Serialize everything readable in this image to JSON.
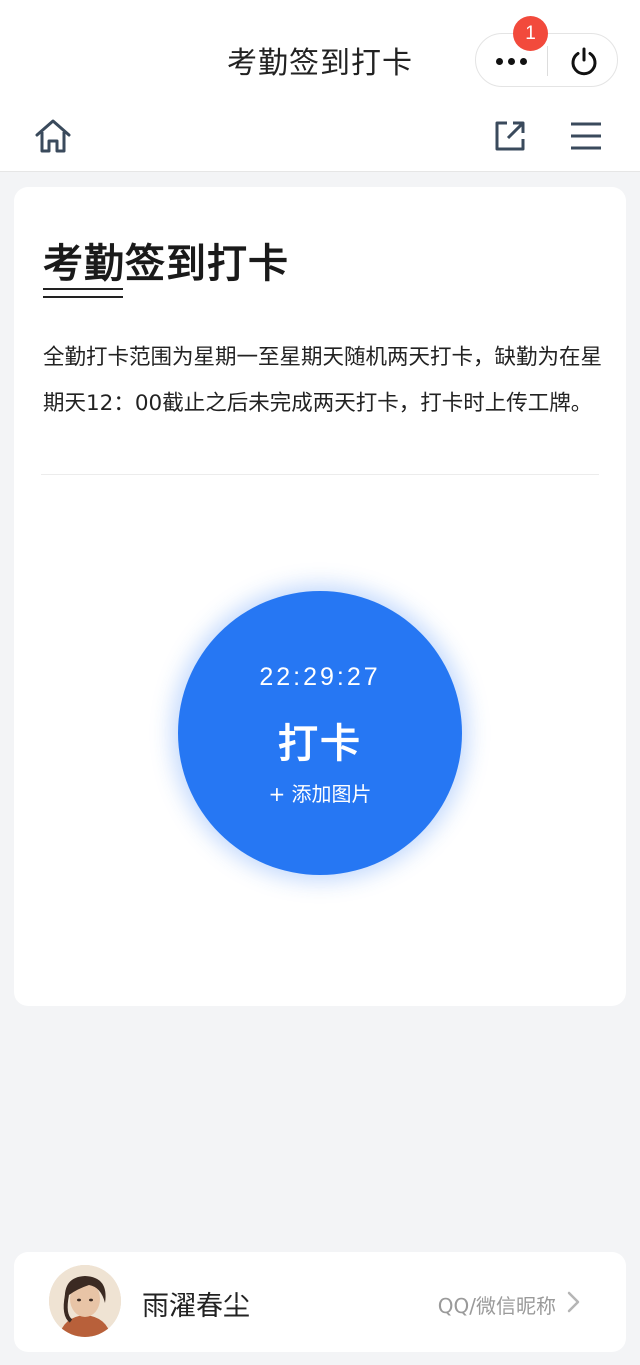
{
  "window": {
    "title": "考勤签到打卡"
  },
  "capsule": {
    "badge_count": "1",
    "more_icon": "more-dots-icon",
    "power_icon": "power-icon"
  },
  "nav": {
    "home_icon": "home-icon",
    "share_icon": "share-external-icon",
    "menu_icon": "hamburger-menu-icon"
  },
  "card": {
    "heading": "考勤签到打卡",
    "description": "全勤打卡范围为星期一至星期天随机两天打卡，缺勤为在星期天12：00截止之后未完成两天打卡，打卡时上传工牌。"
  },
  "punch": {
    "time": "22:29:27",
    "label": "打卡",
    "add_image": "+ 添加图片"
  },
  "user": {
    "name": "雨濯春尘",
    "nickname_hint": "QQ/微信昵称"
  },
  "colors": {
    "accent": "#2677f3",
    "badge": "#f24a3c",
    "background": "#f3f4f6"
  }
}
